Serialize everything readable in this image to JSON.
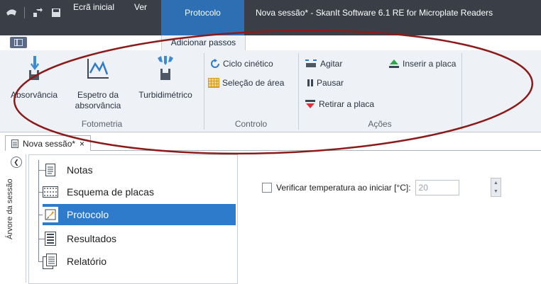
{
  "window": {
    "context_tab": "Protocolo",
    "title": "Nova sessão* - SkanIt Software 6.1 RE for Microplate Readers"
  },
  "ribbon_tabs": [
    "Ecrã inicial",
    "Ver",
    "Adicionar passos"
  ],
  "ribbon": {
    "fotometria": {
      "label": "Fotometria",
      "buttons": [
        "Absorvância",
        "Espetro da absorvância",
        "Turbidimétrico"
      ]
    },
    "controlo": {
      "label": "Controlo",
      "buttons": [
        "Ciclo cinético",
        "Seleção de área"
      ]
    },
    "acoes": {
      "label": "Ações",
      "buttons": [
        "Agitar",
        "Pausar",
        "Retirar a placa",
        "Inserir a placa"
      ]
    }
  },
  "document_tab": {
    "label": "Nova sessão*",
    "close": "×"
  },
  "side_panel_label": "Árvore da sessão",
  "tree": {
    "items": [
      "Notas",
      "Esquema de placas",
      "Protocolo",
      "Resultados",
      "Relatório"
    ],
    "selected": "Protocolo"
  },
  "settings": {
    "check_label": "Verificar temperatura ao iniciar [°C]:",
    "temperature_value": "20"
  },
  "colors": {
    "titlebar": "#3a3f47",
    "context_tab": "#2d6fb2",
    "ribbon_bg": "#eef1f5",
    "tree_selected": "#2f7bcb",
    "annotation_ellipse": "#8b1a1a"
  }
}
